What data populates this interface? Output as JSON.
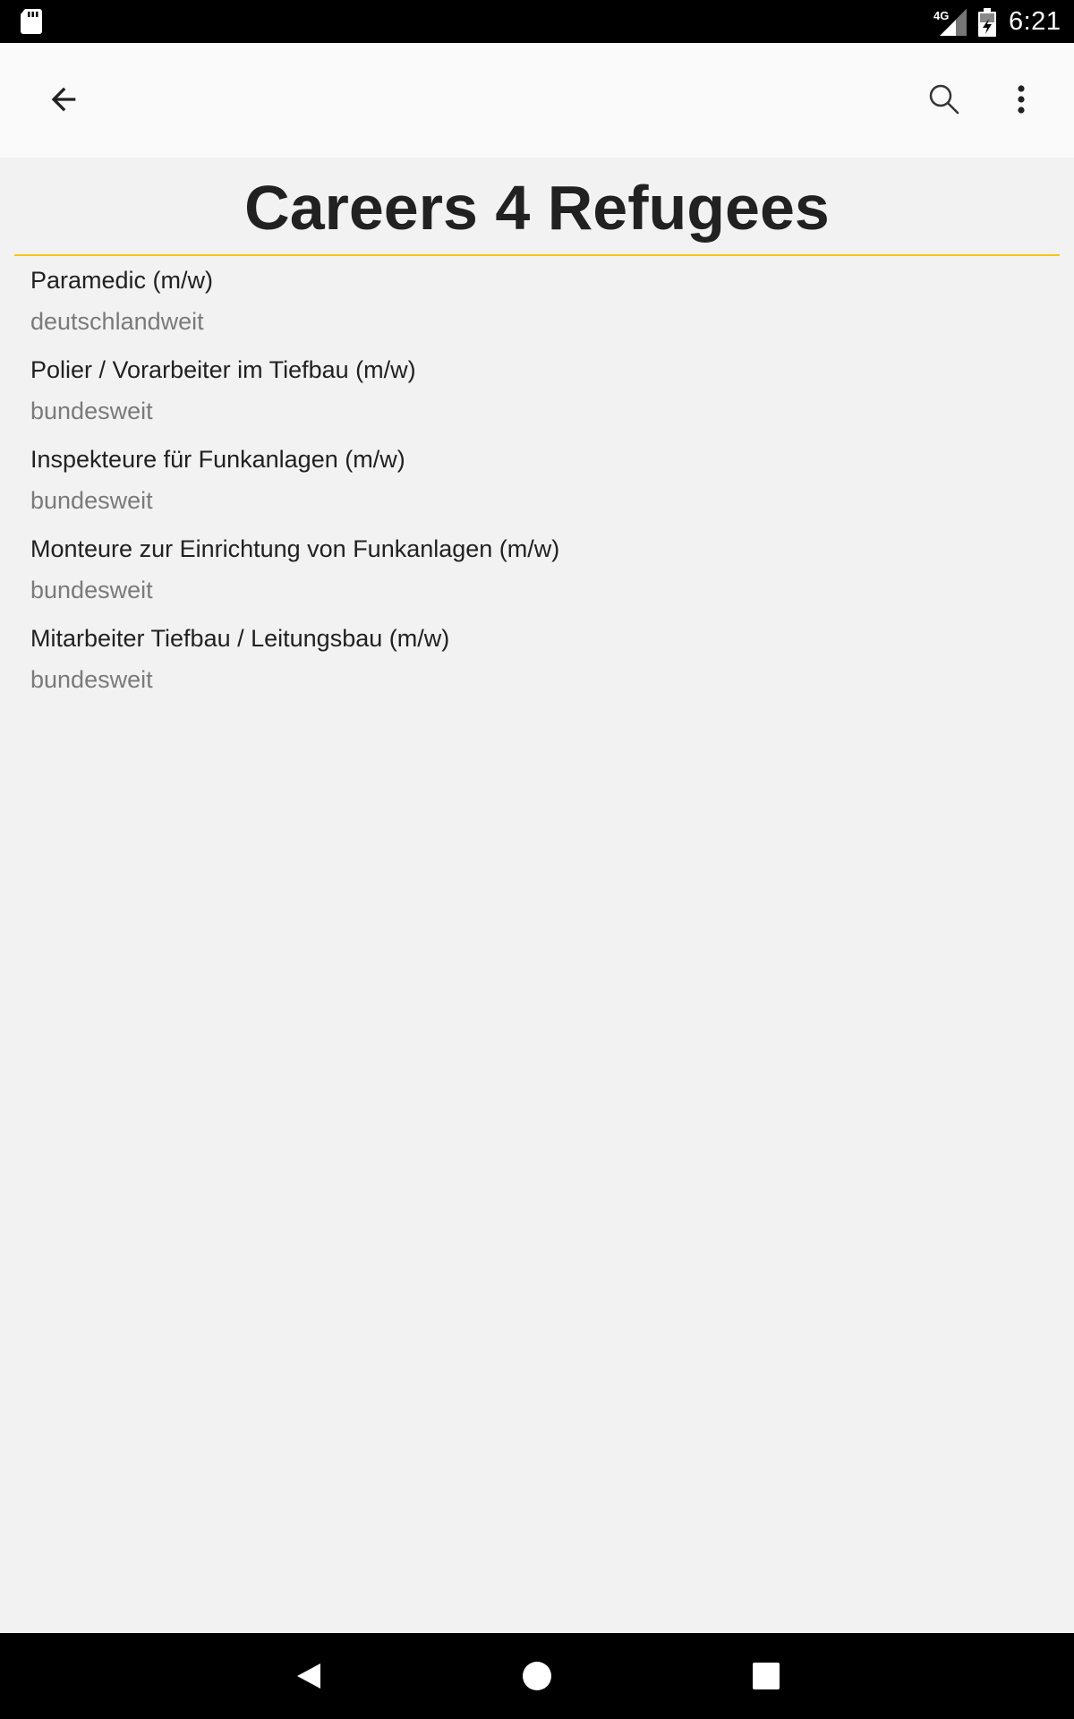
{
  "status_bar": {
    "network": "4G",
    "time": "6:21"
  },
  "app_bar": {
    "back_icon": "arrow-back-icon",
    "search_icon": "search-icon",
    "more_icon": "more-vert-icon"
  },
  "page": {
    "title": "Careers 4 Refugees",
    "accent_color": "#f5c518"
  },
  "jobs": [
    {
      "title": "Paramedic (m/w)",
      "location": "deutschlandweit"
    },
    {
      "title": "Polier / Vorarbeiter im Tiefbau (m/w)",
      "location": "bundesweit"
    },
    {
      "title": "Inspekteure für Funkanlagen (m/w)",
      "location": "bundesweit"
    },
    {
      "title": "Monteure zur Einrichtung von Funkanlagen (m/w)",
      "location": "bundesweit"
    },
    {
      "title": "Mitarbeiter Tiefbau / Leitungsbau (m/w)",
      "location": "bundesweit"
    }
  ],
  "nav_bar": {
    "back_icon": "nav-back-icon",
    "home_icon": "nav-home-icon",
    "recents_icon": "nav-recents-icon"
  }
}
